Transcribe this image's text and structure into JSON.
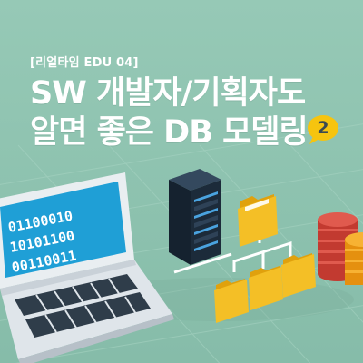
{
  "header": {
    "tag": "[리얼타임 EDU 04]",
    "title_line1": "SW 개발자/기획자도",
    "title_line2": "알면 좋은 DB 모델링",
    "episode": "2"
  },
  "laptop_screen": {
    "binary_lines": [
      "01100010",
      "10101100",
      "00110011"
    ]
  },
  "colors": {
    "background": "#8ec3b0",
    "laptop_screen": "#1f9fd6",
    "server": "#1c2b3a",
    "folder": "#f2b91c",
    "coin_red": "#d8463b",
    "coin_orange": "#f4a019",
    "badge": "#f6c40f"
  }
}
